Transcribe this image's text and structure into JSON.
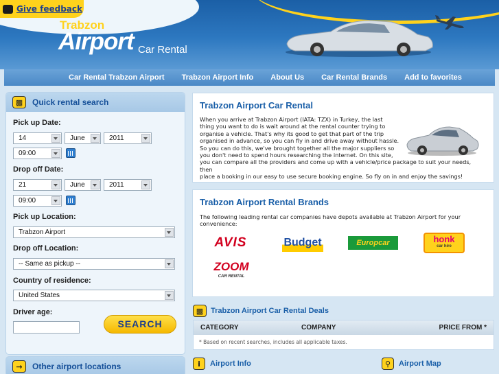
{
  "feedback": {
    "label": "Give feedback"
  },
  "logo": {
    "line1": "Trabzon",
    "line2": "Airport",
    "line3": "Car Rental"
  },
  "nav": [
    "Car Rental Trabzon Airport",
    "Trabzon Airport Info",
    "About Us",
    "Car Rental Brands",
    "Add to favorites"
  ],
  "search": {
    "title": "Quick rental search",
    "pickup_date_label": "Pick up Date:",
    "pickup_day": "14",
    "pickup_month": "June",
    "pickup_year": "2011",
    "pickup_time": "09:00",
    "dropoff_date_label": "Drop off Date:",
    "dropoff_day": "21",
    "dropoff_month": "June",
    "dropoff_year": "2011",
    "dropoff_time": "09:00",
    "pickup_location_label": "Pick up Location:",
    "pickup_location": "Trabzon Airport",
    "dropoff_location_label": "Drop off Location:",
    "dropoff_location": "-- Same as pickup --",
    "country_label": "Country of residence:",
    "country": "United States",
    "age_label": "Driver age:",
    "age_value": "",
    "button": "SEARCH"
  },
  "other": {
    "title": "Other airport locations"
  },
  "intro": {
    "title": "Trabzon Airport Car Rental",
    "lines_narrow": [
      "When you arrive at Trabzon Airport (IATA: TZX) in Turkey, the last",
      "thing you want to do is wait around at the rental counter trying to",
      "organise a vehicle. That's why its good to get that part of the trip",
      "organised in advance, so you can fly in and drive away without hassle.",
      "So you can do this, we've brought together all the major suppliers so",
      "you don't need to spend hours researching the internet. On this site,"
    ],
    "lines_wide": [
      "you can compare all the providers and come up with a vehicle/price package to suit your needs, then",
      "place a booking in our easy to use secure booking engine. So fly on in and enjoy the savings!"
    ]
  },
  "brands": {
    "title": "Trabzon Airport Rental Brands",
    "text1": "The following leading rental car companies have depots available at Trabzon Airport for your",
    "text2": "convenience:",
    "items": [
      {
        "name": "AVIS",
        "color": "#d2001f"
      },
      {
        "name": "Budget",
        "color": "#1f4fa3"
      },
      {
        "name": "Europcar",
        "color": "#1a9a3a"
      },
      {
        "name": "honk",
        "sub": "car hire",
        "color": "#f39200"
      },
      {
        "name": "ZOOM",
        "sub": "CAR RENTAL",
        "color": "#d2001f"
      }
    ]
  },
  "deals": {
    "title": "Trabzon Airport Car Rental Deals",
    "columns": [
      "CATEGORY",
      "COMPANY",
      "PRICE FROM *"
    ],
    "note": "* Based on recent searches, includes all applicable taxes."
  },
  "footer": {
    "info": "Airport Info",
    "map": "Airport Map"
  },
  "colors": {
    "accent": "#ffd21c",
    "heading": "#1a5fa8",
    "nav": "#4a88c6"
  }
}
